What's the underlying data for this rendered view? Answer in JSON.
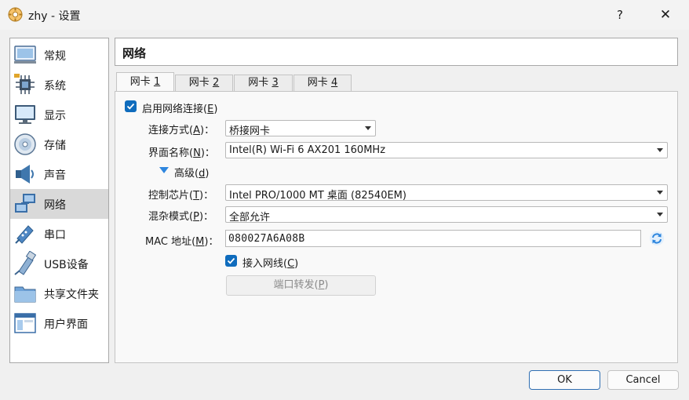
{
  "window": {
    "title": "zhy - 设置",
    "help": "?",
    "close": "✕"
  },
  "sidebar": {
    "items": [
      {
        "label": "常规",
        "icon": "general-icon"
      },
      {
        "label": "系统",
        "icon": "system-chip-icon"
      },
      {
        "label": "显示",
        "icon": "display-monitor-icon"
      },
      {
        "label": "存储",
        "icon": "storage-disc-icon"
      },
      {
        "label": "声音",
        "icon": "speaker-icon"
      },
      {
        "label": "网络",
        "icon": "network-icon",
        "active": true
      },
      {
        "label": "串口",
        "icon": "serial-port-icon"
      },
      {
        "label": "USB设备",
        "icon": "usb-icon"
      },
      {
        "label": "共享文件夹",
        "icon": "shared-folder-icon"
      },
      {
        "label": "用户界面",
        "icon": "user-interface-icon"
      }
    ]
  },
  "page": {
    "title": "网络"
  },
  "tabs": [
    {
      "label": "网卡",
      "key": "1",
      "active": true
    },
    {
      "label": "网卡",
      "key": "2"
    },
    {
      "label": "网卡",
      "key": "3"
    },
    {
      "label": "网卡",
      "key": "4"
    }
  ],
  "adapter": {
    "enable": {
      "label": "启用网络连接",
      "key": "E",
      "checked": true
    },
    "attached_to": {
      "label": "连接方式",
      "key": "A",
      "value": "桥接网卡"
    },
    "name": {
      "label": "界面名称",
      "key": "N",
      "value": "Intel(R) Wi-Fi 6 AX201 160MHz"
    },
    "advanced": {
      "label": "高级",
      "key": "d"
    },
    "adapter_type": {
      "label": "控制芯片",
      "key": "T",
      "value": "Intel PRO/1000 MT 桌面 (82540EM)"
    },
    "promiscuous": {
      "label": "混杂模式",
      "key": "P",
      "value": "全部允许"
    },
    "mac": {
      "label": "MAC 地址",
      "key": "M",
      "value": "080027A6A08B"
    },
    "cable": {
      "label": "接入网线",
      "key": "C",
      "checked": true
    },
    "port_forwarding": {
      "label": "端口转发",
      "key": "P"
    }
  },
  "buttons": {
    "ok": "OK",
    "cancel": "Cancel"
  },
  "colors": {
    "accent": "#0f6cbd",
    "active_item": "#d9d9d9",
    "refresh": "#2e86de"
  }
}
